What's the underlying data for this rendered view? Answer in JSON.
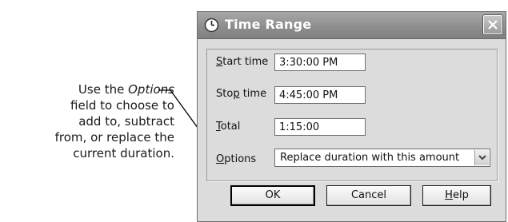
{
  "callout": {
    "line1_before": "Use the ",
    "line1_em": "Options",
    "line2": "field to choose to",
    "line3": "add to, subtract",
    "line4": "from, or replace the",
    "line5": "current duration."
  },
  "dialog": {
    "title": "Time Range",
    "title_icon": "clock-icon",
    "close_icon": "close-icon",
    "fields": {
      "start": {
        "label_u": "S",
        "label_rest": "tart time",
        "value": "3:30:00 PM"
      },
      "stop": {
        "label_pre": "Sto",
        "label_u": "p",
        "label_rest": " time",
        "value": "4:45:00 PM"
      },
      "total": {
        "label_u": "T",
        "label_rest": "otal",
        "value": "1:15:00"
      },
      "options": {
        "label_u": "O",
        "label_rest": "ptions",
        "selected": "Replace duration with this amount"
      }
    },
    "buttons": {
      "ok": "OK",
      "cancel": "Cancel",
      "help_u": "H",
      "help_rest": "elp"
    }
  },
  "colors": {
    "titlebar": "#8e8e8e",
    "dialog_bg": "#dcdcdc"
  }
}
